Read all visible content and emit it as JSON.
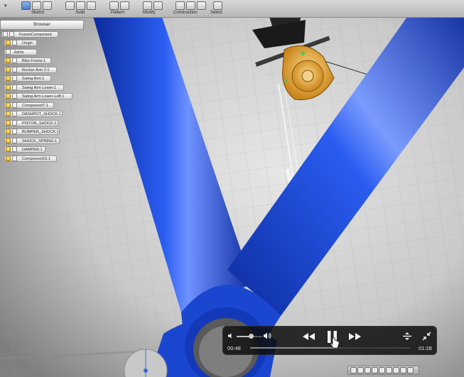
{
  "toolbar": {
    "sections": [
      {
        "label": "Sketch"
      },
      {
        "label": "Solid"
      },
      {
        "label": "Pattern"
      },
      {
        "label": "Modify"
      },
      {
        "label": "Construction"
      },
      {
        "label": "Select"
      }
    ]
  },
  "browser": {
    "title": "Browser",
    "root": "FusionComponent",
    "items": [
      {
        "label": "Origin"
      },
      {
        "label": "Joints"
      },
      {
        "label": "Bike Frame:1"
      },
      {
        "label": "Rocker Arm 2:1"
      },
      {
        "label": "Swing Arm:1"
      },
      {
        "label": "Swing Arm Lower:1"
      },
      {
        "label": "Swing Arm Lower-Left:1"
      },
      {
        "label": "Component7:1"
      },
      {
        "label": "DASHPOT_SHOCK:1"
      },
      {
        "label": "PISTON_SHOCK:1"
      },
      {
        "label": "BUMPER_SHOCK:1"
      },
      {
        "label": "SHOCK_SPRING:1"
      },
      {
        "label": "DAMPER:1"
      },
      {
        "label": "Component15:1"
      }
    ]
  },
  "player": {
    "current_time": "00:48",
    "total_time": "01:28",
    "progress": 0.545,
    "volume": 0.55
  },
  "colors": {
    "frame_blue": "#1f4fd8",
    "rocker_orange": "#e0a23a",
    "grid_bg": "#d0d0d0"
  }
}
